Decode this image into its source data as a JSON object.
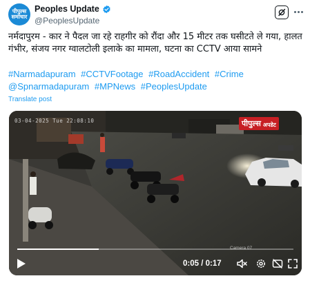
{
  "header": {
    "avatar_text_line1": "पीपुल्स",
    "avatar_text_line2": "समाचार",
    "display_name": "Peoples Update",
    "handle": "@PeoplesUpdate",
    "verified_color": "#1d9bf0",
    "grok_icon": "grok-icon",
    "more_icon": "more-icon"
  },
  "post": {
    "text": "नर्मदापुरम - कार ने पैदल जा रहे राहगीर को रौंदा और 15 मीटर तक घसीटते ले गया, हालत गंभीर, संजय नगर ग्वालटोली इलाके का मामला, घटना का CCTV आया सामने",
    "hashtags": [
      "#Narmadapuram",
      "#CCTVFootage",
      "#RoadAccident",
      "#Crime",
      "@Spnarmadapuram",
      "#MPNews",
      "#PeoplesUpdate"
    ],
    "translate_label": "Translate post",
    "link_color": "#1d9bf0"
  },
  "video": {
    "timestamp_overlay": "03-04-2025 Tue 22:08:10",
    "logo_part1": "पीपुल्स",
    "logo_part2": "अपडेट",
    "camera_label": "Camera 07",
    "progress_fraction": 0.294,
    "current_time": "0:05",
    "duration": "0:17",
    "time_separator": " / ",
    "controls": {
      "play": "play-icon",
      "volume": "volume-icon",
      "settings": "settings-icon",
      "fullscreen": "fullscreen-icon"
    }
  }
}
